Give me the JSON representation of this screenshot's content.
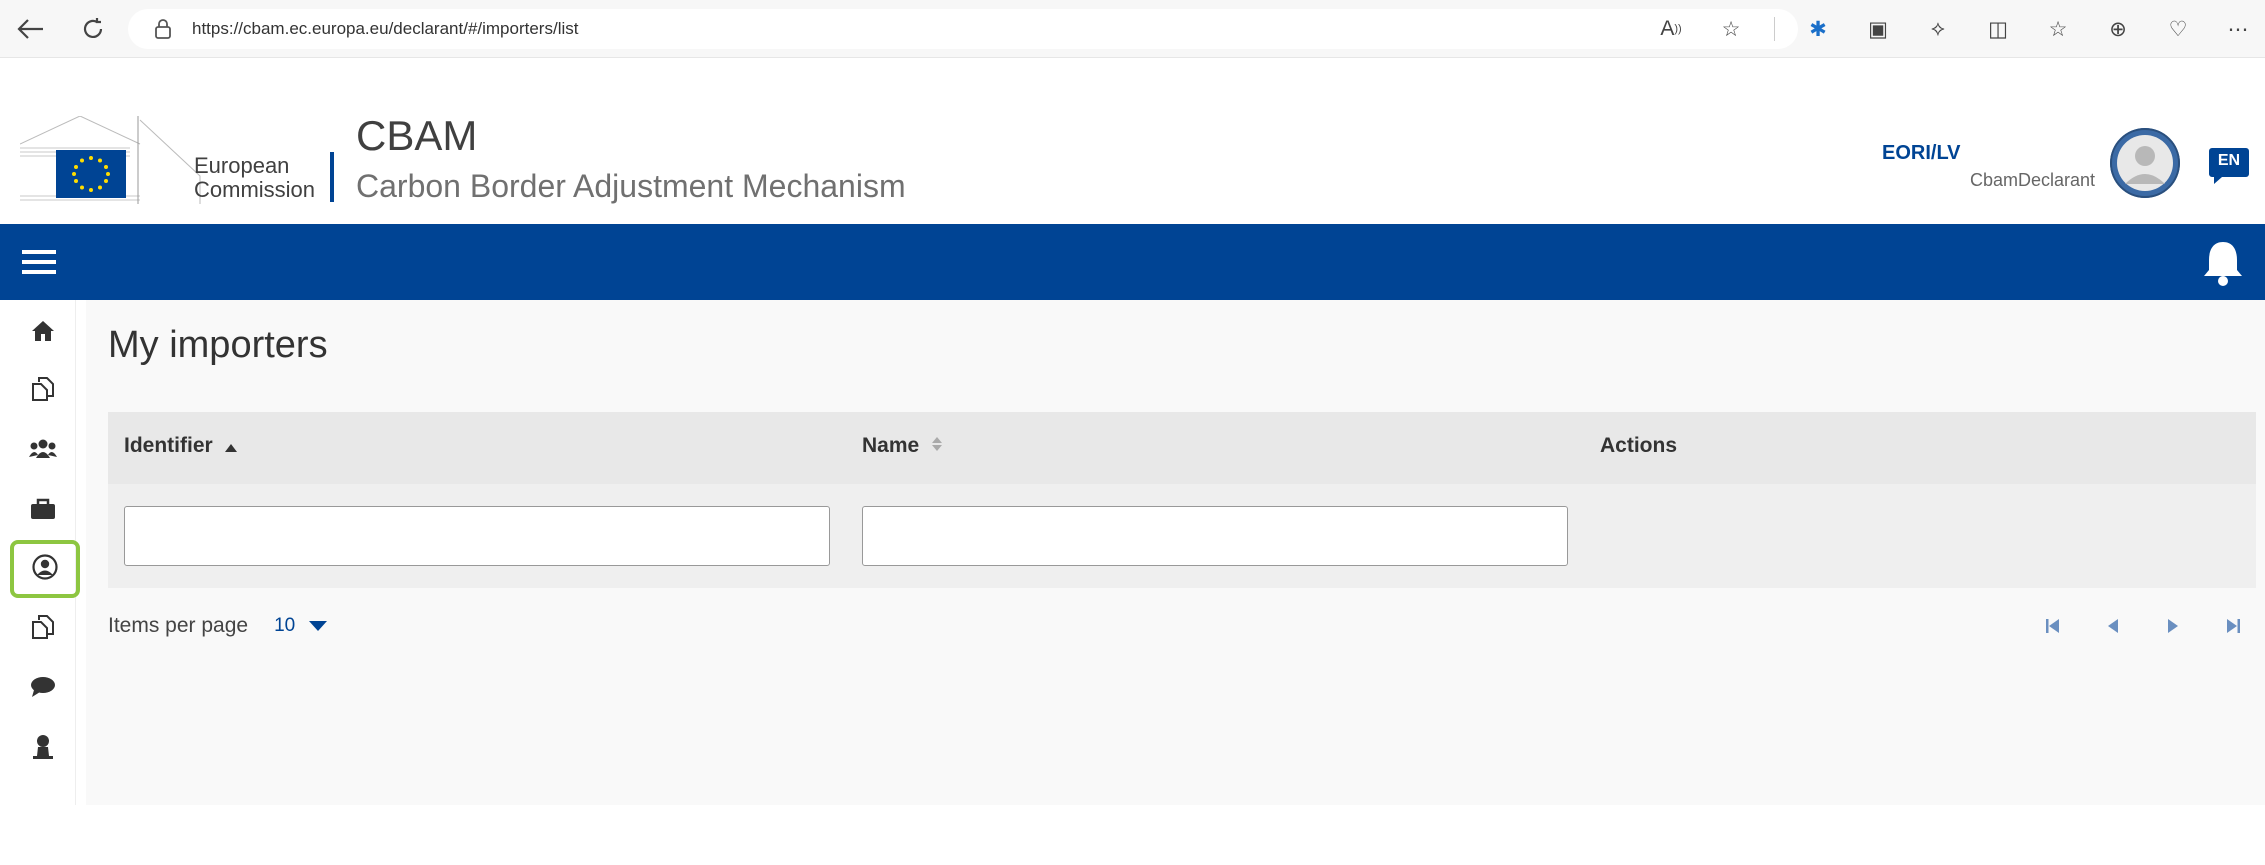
{
  "browser": {
    "url": "https://cbam.ec.europa.eu/declarant/#/importers/list",
    "icons": [
      "back-icon",
      "refresh-icon",
      "read-aloud-icon",
      "favorite-star-icon",
      "extension-icon",
      "wallet-icon",
      "copilot-icon",
      "split-screen-icon",
      "favorites-icon",
      "collections-icon",
      "health-icon",
      "more-icon"
    ]
  },
  "header": {
    "org_line1": "European",
    "org_line2": "Commission",
    "app_title": "CBAM",
    "app_subtitle": "Carbon Border Adjustment Mechanism",
    "user_id": "EORI/LV",
    "user_role": "CbamDeclarant",
    "language": "EN"
  },
  "sidebar": {
    "items": [
      {
        "name": "home",
        "icon": "home-icon"
      },
      {
        "name": "declarations",
        "icon": "copy-icon"
      },
      {
        "name": "users",
        "icon": "users-icon"
      },
      {
        "name": "briefcase",
        "icon": "briefcase-icon"
      },
      {
        "name": "importers",
        "icon": "user-circle-icon",
        "active": true
      },
      {
        "name": "documents",
        "icon": "copy-icon"
      },
      {
        "name": "messages",
        "icon": "chat-icon"
      },
      {
        "name": "profile",
        "icon": "person-icon"
      }
    ],
    "active_color": "#8dc641"
  },
  "main": {
    "title": "My importers",
    "columns": [
      {
        "label": "Identifier",
        "sort": "asc"
      },
      {
        "label": "Name",
        "sort": "none"
      },
      {
        "label": "Actions",
        "sort": ""
      }
    ],
    "filters": {
      "identifier": "",
      "name": ""
    },
    "pager": {
      "items_per_page_label": "Items per page",
      "items_per_page": "10"
    }
  },
  "colors": {
    "brand_blue": "#004494",
    "header_bg": "#e8e8e8"
  }
}
